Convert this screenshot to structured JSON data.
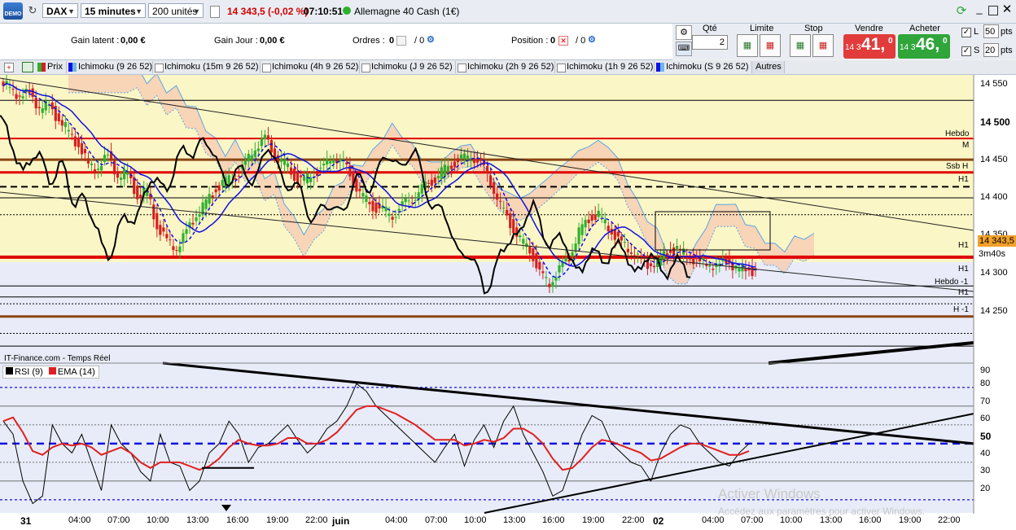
{
  "toolbar": {
    "demo": "DEMO",
    "instrument": "DAX",
    "timeframe": "15 minutes",
    "units": "200 unités",
    "price_change": "14 343,5 (-0,02 %)",
    "time": "07:10:51",
    "market": "Allemagne 40 Cash (1€)"
  },
  "account": {
    "gain_latent_label": "Gain latent :",
    "gain_latent": "0,00 €",
    "gain_jour_label": "Gain Jour :",
    "gain_jour": "0,00 €",
    "ordres_label": "Ordres :",
    "ordres": "0",
    "ordres_total": "/ 0",
    "position_label": "Position :",
    "position": "0",
    "position_total": "/ 0"
  },
  "order": {
    "qte_label": "Qté",
    "qte": "2",
    "limite_label": "Limite",
    "stop_label": "Stop",
    "vendre_label": "Vendre",
    "vendre_small": "14 3",
    "vendre_big": "41,",
    "vendre_sup": "0",
    "acheter_label": "Acheter",
    "acheter_small": "14 3",
    "acheter_big": "46,",
    "acheter_sup": "0",
    "l_label": "L",
    "l_value": "50",
    "s_label": "S",
    "s_value": "20",
    "pts": "pts"
  },
  "tabs": [
    "Prix",
    "Ichimoku (9 26 52)",
    "Ichimoku (15m 9 26 52)",
    "Ichimoku (4h 9 26 52)",
    "Ichimoku (J 9 26 52)",
    "Ichimoku (2h 9 26 52)",
    "Ichimoku (1h 9 26 52)",
    "Ichimoku (S 9 26 52)",
    "Autres"
  ],
  "price_axis": [
    "14 550",
    "14 500",
    "14 450",
    "14 400",
    "14 350",
    "14 300",
    "14 250"
  ],
  "level_labels": [
    "Hebdo",
    "M",
    "Ssb H",
    "H1",
    "H1",
    "H1",
    "Hebdo -1",
    "H1",
    "H -1"
  ],
  "current_price": "14 343,5",
  "countdown": "3m40s",
  "source": "IT-Finance.com - Temps Réel",
  "rsi_legend": {
    "rsi": "RSI (9)",
    "ema": "EMA (14)"
  },
  "rsi_axis": [
    "90",
    "80",
    "70",
    "60",
    "50",
    "40",
    "30",
    "20"
  ],
  "time_axis": [
    "31",
    "04:00",
    "07:00",
    "10:00",
    "13:00",
    "16:00",
    "19:00",
    "22:00",
    "juin",
    "04:00",
    "07:00",
    "10:00",
    "13:00",
    "16:00",
    "19:00",
    "22:00",
    "02",
    "04:00",
    "07:00",
    "10:00",
    "13:00",
    "16:00",
    "19:00",
    "22:00"
  ],
  "watermark": {
    "title": "Activer Windows",
    "sub": "Accédez aux paramètres pour activer Windows."
  },
  "colors": {
    "sell": "#e23b3b",
    "buy": "#2fa53a",
    "bull": "#2fb02f",
    "bear": "#d42020",
    "level": "#e00000",
    "hebdo": "#8b4513",
    "plotbg": "#fbf6c6",
    "rsibg": "#e8ecf8"
  },
  "chart_data": {
    "type": "candlestick",
    "price_range": [
      14235,
      14575
    ],
    "rsi_range": [
      13,
      93
    ],
    "ohlc_path": [
      14562,
      14548,
      14555,
      14535,
      14540,
      14520,
      14510,
      14490,
      14470,
      14465,
      14480,
      14455,
      14460,
      14430,
      14440,
      14395,
      14380,
      14370,
      14390,
      14410,
      14425,
      14440,
      14450,
      14455,
      14470,
      14490,
      14500,
      14480,
      14470,
      14455,
      14450,
      14460,
      14465,
      14480,
      14470,
      14450,
      14430,
      14420,
      14415,
      14410,
      14420,
      14430,
      14440,
      14450,
      14460,
      14470,
      14475,
      14480,
      14470,
      14450,
      14420,
      14400,
      14380,
      14370,
      14340,
      14330,
      14345,
      14360,
      14390,
      14405,
      14410,
      14395,
      14380,
      14370,
      14360,
      14350,
      14355,
      14365,
      14370,
      14362,
      14355,
      14352,
      14350,
      14355,
      14348,
      14345,
      14343
    ],
    "rsi": [
      62,
      55,
      30,
      18,
      22,
      60,
      50,
      45,
      55,
      40,
      25,
      60,
      50,
      45,
      35,
      30,
      55,
      40,
      38,
      25,
      30,
      45,
      50,
      62,
      55,
      40,
      48,
      50,
      55,
      60,
      52,
      45,
      50,
      58,
      62,
      70,
      82,
      78,
      70,
      65,
      60,
      55,
      50,
      45,
      40,
      48,
      55,
      38,
      52,
      60,
      48,
      62,
      70,
      55,
      45,
      35,
      22,
      25,
      40,
      55,
      65,
      62,
      50,
      45,
      40,
      38,
      30,
      45,
      55,
      60,
      58,
      50,
      45,
      40,
      38,
      45,
      50
    ],
    "ema": [
      62,
      64,
      56,
      46,
      44,
      48,
      50,
      49,
      50,
      48,
      44,
      46,
      48,
      45,
      40,
      37,
      40,
      40,
      40,
      38,
      36,
      38,
      42,
      48,
      52,
      50,
      49,
      49,
      50,
      53,
      53,
      50,
      50,
      52,
      56,
      62,
      68,
      70,
      70,
      68,
      66,
      63,
      60,
      56,
      52,
      52,
      52,
      49,
      50,
      52,
      51,
      53,
      58,
      58,
      55,
      50,
      42,
      36,
      37,
      42,
      48,
      52,
      51,
      49,
      47,
      45,
      41,
      42,
      45,
      48,
      50,
      50,
      48,
      46,
      44,
      44,
      46
    ]
  }
}
